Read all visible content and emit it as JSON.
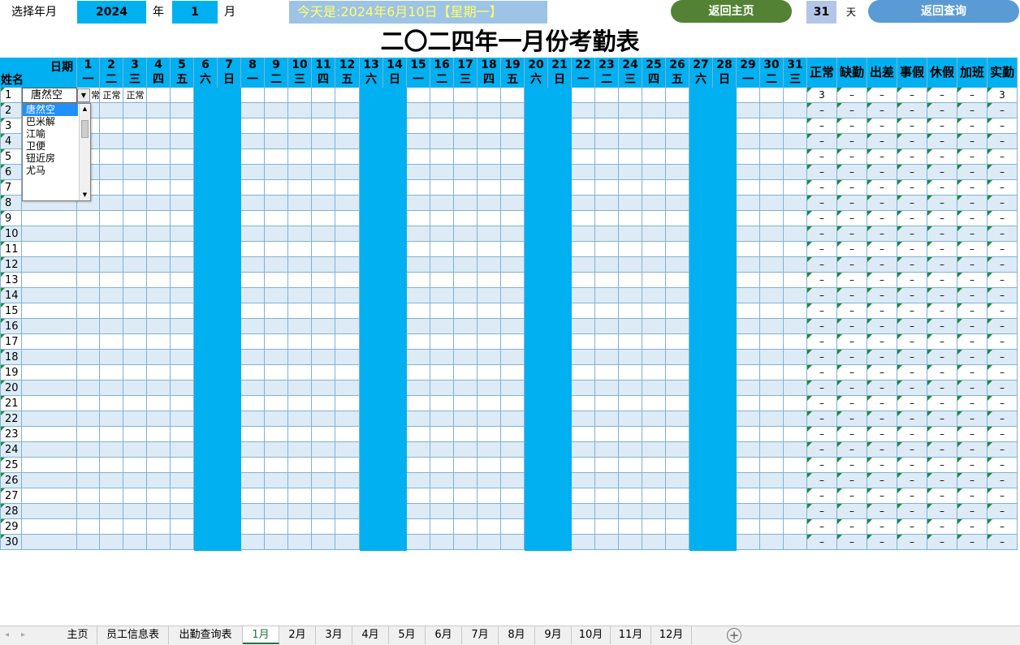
{
  "top": {
    "select_label": "选择年月",
    "year_value": "2024",
    "year_unit": "年",
    "month_value": "1",
    "month_unit": "月",
    "today_text": "今天是:2024年6月10日【星期一】",
    "home_button": "返回主页",
    "days_in_month": "31",
    "days_unit": "天",
    "query_button": "返回查询"
  },
  "title": "二〇二四年一月份考勤表",
  "header": {
    "date_label": "日期",
    "name_label": "姓名",
    "days": [
      {
        "d": "1",
        "w": "一"
      },
      {
        "d": "2",
        "w": "二"
      },
      {
        "d": "3",
        "w": "三"
      },
      {
        "d": "4",
        "w": "四"
      },
      {
        "d": "5",
        "w": "五"
      },
      {
        "d": "6",
        "w": "六"
      },
      {
        "d": "7",
        "w": "日"
      },
      {
        "d": "8",
        "w": "一"
      },
      {
        "d": "9",
        "w": "二"
      },
      {
        "d": "10",
        "w": "三"
      },
      {
        "d": "11",
        "w": "四"
      },
      {
        "d": "12",
        "w": "五"
      },
      {
        "d": "13",
        "w": "六"
      },
      {
        "d": "14",
        "w": "日"
      },
      {
        "d": "15",
        "w": "一"
      },
      {
        "d": "16",
        "w": "二"
      },
      {
        "d": "17",
        "w": "三"
      },
      {
        "d": "18",
        "w": "四"
      },
      {
        "d": "19",
        "w": "五"
      },
      {
        "d": "20",
        "w": "六"
      },
      {
        "d": "21",
        "w": "日"
      },
      {
        "d": "22",
        "w": "一"
      },
      {
        "d": "23",
        "w": "二"
      },
      {
        "d": "24",
        "w": "三"
      },
      {
        "d": "25",
        "w": "四"
      },
      {
        "d": "26",
        "w": "五"
      },
      {
        "d": "27",
        "w": "六"
      },
      {
        "d": "28",
        "w": "日"
      },
      {
        "d": "29",
        "w": "一"
      },
      {
        "d": "30",
        "w": "二"
      },
      {
        "d": "31",
        "w": "三"
      }
    ],
    "summary": [
      "正常",
      "缺勤",
      "出差",
      "事假",
      "休假",
      "加班",
      "实勤"
    ]
  },
  "rows_count": 30,
  "row1": {
    "name": "唐然空",
    "day_values": [
      "常",
      "正常",
      "正常"
    ],
    "summary_values": [
      "3",
      "–",
      "–",
      "–",
      "–",
      "–",
      "3"
    ]
  },
  "empty_summary_value": "–",
  "dropdown": {
    "items": [
      "唐然空",
      "巴米解",
      "江喻",
      "卫便",
      "钮近房",
      "尤马"
    ],
    "selected_index": 0
  },
  "tabs": [
    "主页",
    "员工信息表",
    "出勤查询表",
    "1月",
    "2月",
    "3月",
    "4月",
    "5月",
    "6月",
    "7月",
    "8月",
    "9月",
    "10月",
    "11月",
    "12月"
  ],
  "active_tab": "1月",
  "colors": {
    "header_blue": "#00b0f0",
    "weekend_blue": "#00b0f0",
    "stripe_blue": "#ddebf7",
    "home_green": "#548235",
    "query_blue": "#5b9bd5",
    "today_text_yellow": "#ffff66"
  }
}
